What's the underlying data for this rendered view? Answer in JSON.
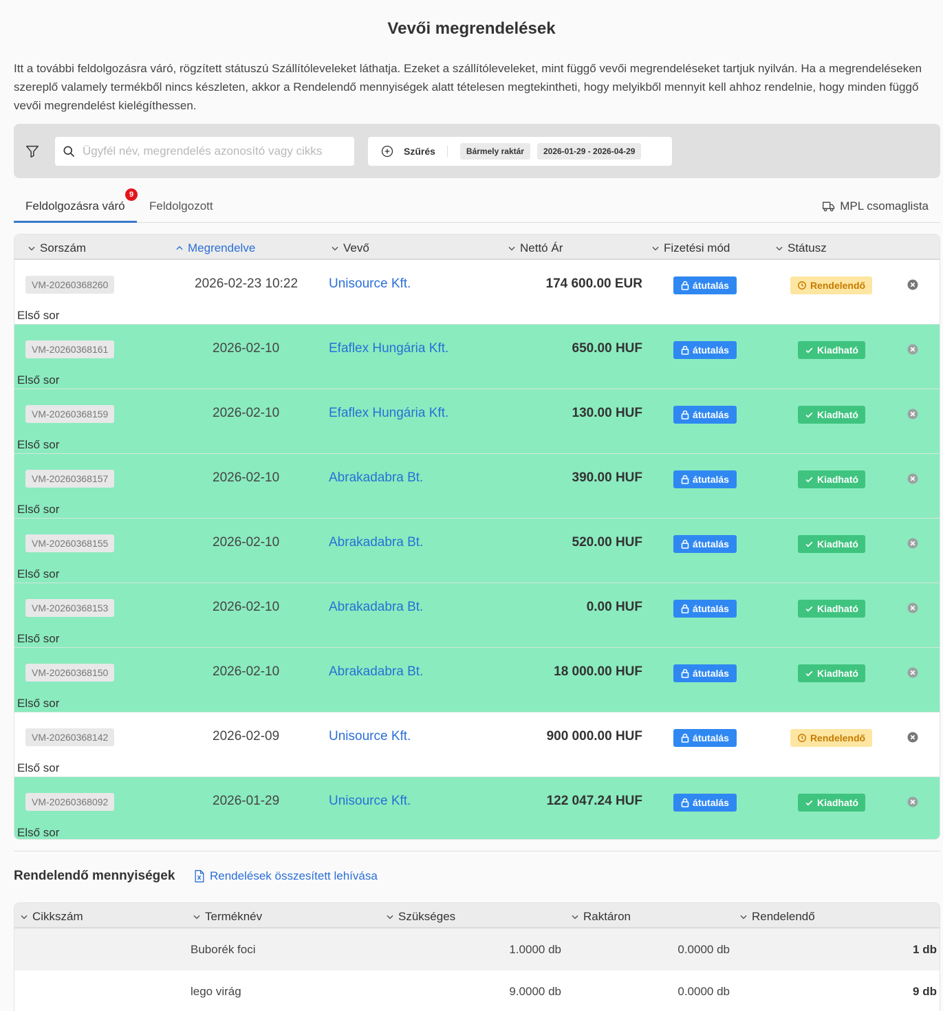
{
  "page": {
    "title": "Vevői megrendelések",
    "intro": "Itt a további feldolgozásra váró, rögzített státuszú Szállítóleveleket láthatja. Ezeket a szállítóleveleket, mint függő vevői megrendeléseket tartjuk nyilván. Ha a megrendeléseken szereplő valamely termékből nincs készleten, akkor a Rendelendő mennyiségek alatt tételesen megtekintheti, hogy melyikből mennyit kell ahhoz rendelnie, hogy minden függő vevői megrendelést kielégíthessen."
  },
  "toolbar": {
    "search_placeholder": "Ügyfél név, megrendelés azonosító vagy cikks",
    "filter_label": "Szűrés",
    "chips": [
      "Bármely raktár",
      "2026-01-29 - 2026-04-29"
    ]
  },
  "tabs": {
    "pending": "Feldolgozásra váró",
    "pending_count": "9",
    "processed": "Feldolgozott",
    "mpl": "MPL csomaglista"
  },
  "orders_table": {
    "headers": {
      "sorszam": "Sorszám",
      "megrendelve": "Megrendelve",
      "vevo": "Vevő",
      "netto": "Nettó Ár",
      "fizetesi": "Fizetési mód",
      "statusz": "Státusz"
    },
    "rows": [
      {
        "id": "VM-20260368260",
        "date": "2026-02-23 10:22",
        "customer": "Unisource Kft.",
        "price": "174 600.00 EUR",
        "payment": "átutalás",
        "status": "Rendelendő",
        "note": "Első sor"
      },
      {
        "id": "VM-20260368161",
        "date": "2026-02-10",
        "customer": "Efaflex Hungária Kft.",
        "price": "650.00 HUF",
        "payment": "átutalás",
        "status": "Kiadható",
        "note": "Első sor"
      },
      {
        "id": "VM-20260368159",
        "date": "2026-02-10",
        "customer": "Efaflex Hungária Kft.",
        "price": "130.00 HUF",
        "payment": "átutalás",
        "status": "Kiadható",
        "note": "Első sor"
      },
      {
        "id": "VM-20260368157",
        "date": "2026-02-10",
        "customer": "Abrakadabra Bt.",
        "price": "390.00 HUF",
        "payment": "átutalás",
        "status": "Kiadható",
        "note": "Első sor"
      },
      {
        "id": "VM-20260368155",
        "date": "2026-02-10",
        "customer": "Abrakadabra Bt.",
        "price": "520.00 HUF",
        "payment": "átutalás",
        "status": "Kiadható",
        "note": "Első sor"
      },
      {
        "id": "VM-20260368153",
        "date": "2026-02-10",
        "customer": "Abrakadabra Bt.",
        "price": "0.00 HUF",
        "payment": "átutalás",
        "status": "Kiadható",
        "note": "Első sor"
      },
      {
        "id": "VM-20260368150",
        "date": "2026-02-10",
        "customer": "Abrakadabra Bt.",
        "price": "18 000.00 HUF",
        "payment": "átutalás",
        "status": "Kiadható",
        "note": "Első sor"
      },
      {
        "id": "VM-20260368142",
        "date": "2026-02-09",
        "customer": "Unisource Kft.",
        "price": "900 000.00 HUF",
        "payment": "átutalás",
        "status": "Rendelendő",
        "note": "Első sor"
      },
      {
        "id": "VM-20260368092",
        "date": "2026-01-29",
        "customer": "Unisource Kft.",
        "price": "122 047.24 HUF",
        "payment": "átutalás",
        "status": "Kiadható",
        "note": "Első sor"
      }
    ]
  },
  "quantities": {
    "title": "Rendelendő mennyiségek",
    "link": "Rendelések összesített lehívása",
    "headers": {
      "cikkszam": "Cikkszám",
      "termeknev": "Terméknév",
      "szukseges": "Szükséges",
      "raktaron": "Raktáron",
      "rendelendo": "Rendelendő"
    },
    "rows": [
      {
        "sku": "",
        "name": "Buborék foci",
        "needed": "1.0000 db",
        "stock": "0.0000 db",
        "order": "1 db"
      },
      {
        "sku": "",
        "name": "lego virág",
        "needed": "9.0000 db",
        "stock": "0.0000 db",
        "order": "9 db"
      }
    ]
  },
  "colors": {
    "accent": "#2a6fd6",
    "row_ready": "#8aebbe",
    "status_ready": "#3fc47f",
    "status_order": "#fde6a1",
    "payment": "#2f88f2",
    "badge": "#e2151b"
  }
}
